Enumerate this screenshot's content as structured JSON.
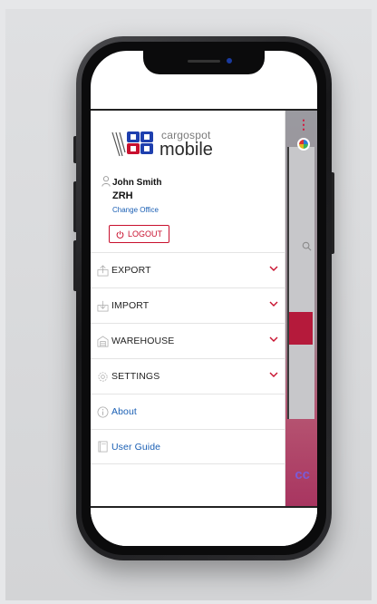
{
  "app": {
    "logo_small": "cargospot",
    "logo_big": "mobile"
  },
  "user": {
    "name": "John Smith",
    "office": "ZRH",
    "change_office": "Change Office"
  },
  "logout_label": "LOGOUT",
  "menu": [
    {
      "label": "EXPORT",
      "icon": "export-icon",
      "expandable": true
    },
    {
      "label": "IMPORT",
      "icon": "import-icon",
      "expandable": true
    },
    {
      "label": "WAREHOUSE",
      "icon": "warehouse-icon",
      "expandable": true
    },
    {
      "label": "SETTINGS",
      "icon": "settings-icon",
      "expandable": true
    },
    {
      "label": "About",
      "icon": "info-icon",
      "expandable": false
    },
    {
      "label": "User Guide",
      "icon": "book-icon",
      "expandable": false
    }
  ],
  "colors": {
    "accent_red": "#c8102e",
    "link_blue": "#1a5fb4",
    "logo_blue": "#1e3fae"
  }
}
